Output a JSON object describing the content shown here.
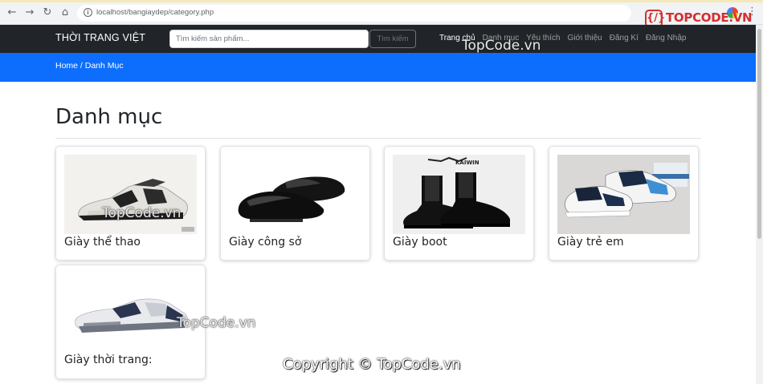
{
  "browser": {
    "url": "localhost/bangiaydep/category.php"
  },
  "watermark": {
    "logo_text": "TOPCODE.VN",
    "logo_badge": "{/}",
    "text": "TopCode.vn",
    "copyright": "Copyright © TopCode.vn"
  },
  "navbar": {
    "brand": "THỜI TRANG VIỆT",
    "search_placeholder": "Tìm kiếm sản phẩm...",
    "search_button": "Tìm kiếm",
    "links": [
      "Trang chủ",
      "Danh mục",
      "Yêu thích",
      "Giới thiệu",
      "Đăng Kí",
      "Đăng Nhập"
    ]
  },
  "breadcrumb": "Home / Danh Mục",
  "page": {
    "title": "Danh mục"
  },
  "categories": [
    {
      "label": "Giày thể thao"
    },
    {
      "label": "Giày công sở"
    },
    {
      "label": "Giày boot"
    },
    {
      "label": "Giày trẻ em"
    },
    {
      "label": "Giày thời trang:"
    }
  ],
  "colors": {
    "navbar": "#212529",
    "primary": "#0d6efd",
    "watermark_red": "#d32f2f"
  }
}
